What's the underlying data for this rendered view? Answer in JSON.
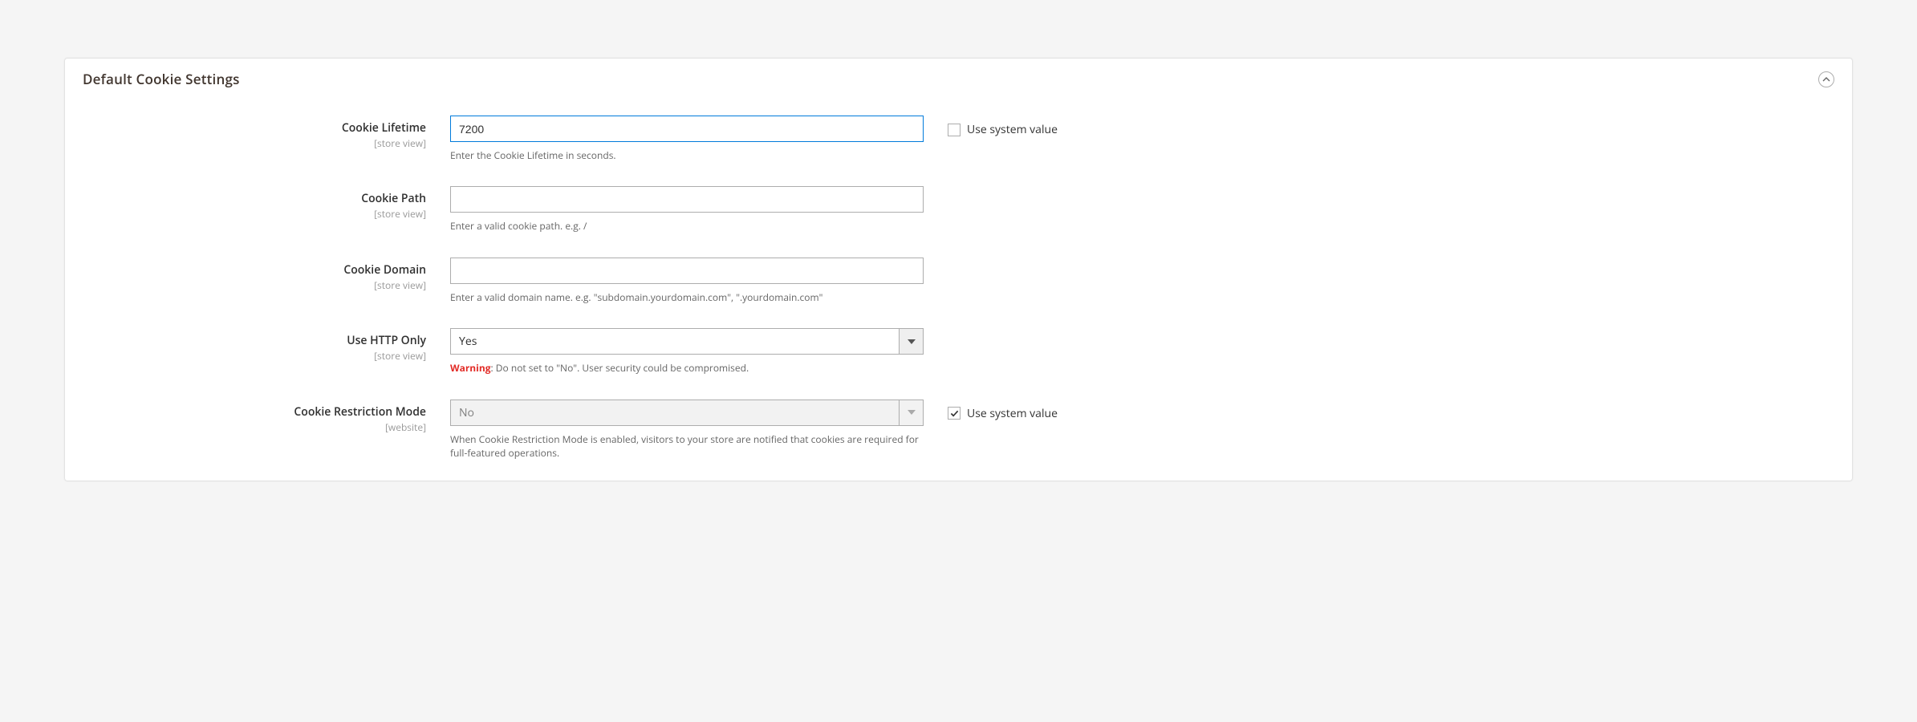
{
  "section": {
    "title": "Default Cookie Settings"
  },
  "labels": {
    "use_system_value": "Use system value",
    "warning_word": "Warning"
  },
  "fields": {
    "cookie_lifetime": {
      "label": "Cookie Lifetime",
      "scope": "[store view]",
      "value": "7200",
      "helper": "Enter the Cookie Lifetime in seconds.",
      "use_system": false
    },
    "cookie_path": {
      "label": "Cookie Path",
      "scope": "[store view]",
      "value": "",
      "helper": "Enter a valid cookie path. e.g. /"
    },
    "cookie_domain": {
      "label": "Cookie Domain",
      "scope": "[store view]",
      "value": "",
      "helper": "Enter a valid domain name. e.g. \"subdomain.yourdomain.com\", \".yourdomain.com\""
    },
    "use_http_only": {
      "label": "Use HTTP Only",
      "scope": "[store view]",
      "value": "Yes",
      "helper_rest": ": Do not set to \"No\". User security could be compromised."
    },
    "cookie_restriction_mode": {
      "label": "Cookie Restriction Mode",
      "scope": "[website]",
      "value": "No",
      "helper": "When Cookie Restriction Mode is enabled, visitors to your store are notified that cookies are required for full-featured operations.",
      "use_system": true
    }
  }
}
